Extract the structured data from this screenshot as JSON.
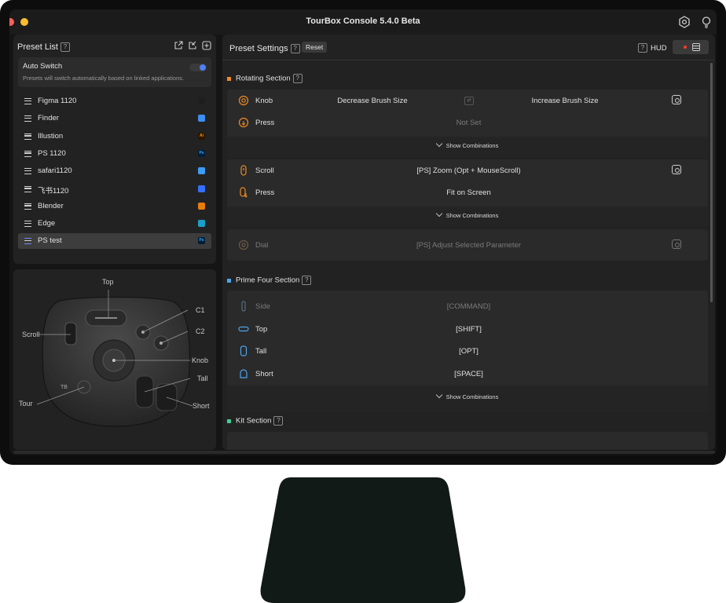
{
  "app": {
    "title": "TourBox Console 5.4.0 Beta"
  },
  "preset_list": {
    "title": "Preset List",
    "help": "?",
    "auto_switch": {
      "label": "Auto Switch",
      "description": "Presets will switch automatically based on linked applications.",
      "enabled": true
    },
    "items": [
      {
        "label": "Figma 1120",
        "app_icon": "figma-icon",
        "color": "#1e1e1e"
      },
      {
        "label": "Finder",
        "app_icon": "finder-icon",
        "color": "#3d8ef0"
      },
      {
        "label": "Illustion",
        "app_icon": "illustrator-icon",
        "color": "#2b1600",
        "badge": "Ai"
      },
      {
        "label": "PS 1120",
        "app_icon": "photoshop-icon",
        "color": "#001e36",
        "badge": "Ps"
      },
      {
        "label": "safari1120",
        "app_icon": "safari-icon",
        "color": "#3a9cf5"
      },
      {
        "label": "飞书1120",
        "app_icon": "feishu-icon",
        "color": "#3370ff"
      },
      {
        "label": "Blender",
        "app_icon": "blender-icon",
        "color": "#e87d0d"
      },
      {
        "label": "Edge",
        "app_icon": "edge-icon",
        "color": "#1aa0c8"
      },
      {
        "label": "PS test",
        "app_icon": "photoshop-icon",
        "color": "#001e36",
        "badge": "Ps",
        "selected": true
      }
    ]
  },
  "device_labels": {
    "top": "Top",
    "c1": "C1",
    "c2": "C2",
    "scroll": "Scroll",
    "knob": "Knob",
    "tall": "Tall",
    "tour": "Tour",
    "short": "Short"
  },
  "preset_settings": {
    "title": "Preset Settings",
    "help": "?",
    "reset": "Reset",
    "hud_help": "?",
    "hud": "HUD"
  },
  "rotating_section": {
    "title": "Rotating Section",
    "color": "#f08a24",
    "knob": {
      "name": "Knob",
      "left": "Decrease Brush Size",
      "right": "Increase Brush Size"
    },
    "knob_press": {
      "name": "Press",
      "value": "Not Set"
    },
    "scroll": {
      "name": "Scroll",
      "value": "[PS] Zoom (Opt + MouseScroll)"
    },
    "scroll_press": {
      "name": "Press",
      "value": "Fit on Screen"
    },
    "dial": {
      "name": "Dial",
      "value": "[PS] Adjust Selected Parameter"
    },
    "show_combinations": "Show Combinations"
  },
  "prime_four_section": {
    "title": "Prime Four Section",
    "color": "#4aa3f0",
    "side": {
      "name": "Side",
      "value": "[COMMAND]"
    },
    "top": {
      "name": "Top",
      "value": "[SHIFT]"
    },
    "tall": {
      "name": "Tall",
      "value": "[OPT]"
    },
    "short": {
      "name": "Short",
      "value": "[SPACE]"
    },
    "show_combinations": "Show Combinations"
  },
  "kit_section": {
    "title": "Kit Section",
    "color": "#3ecf8e"
  }
}
